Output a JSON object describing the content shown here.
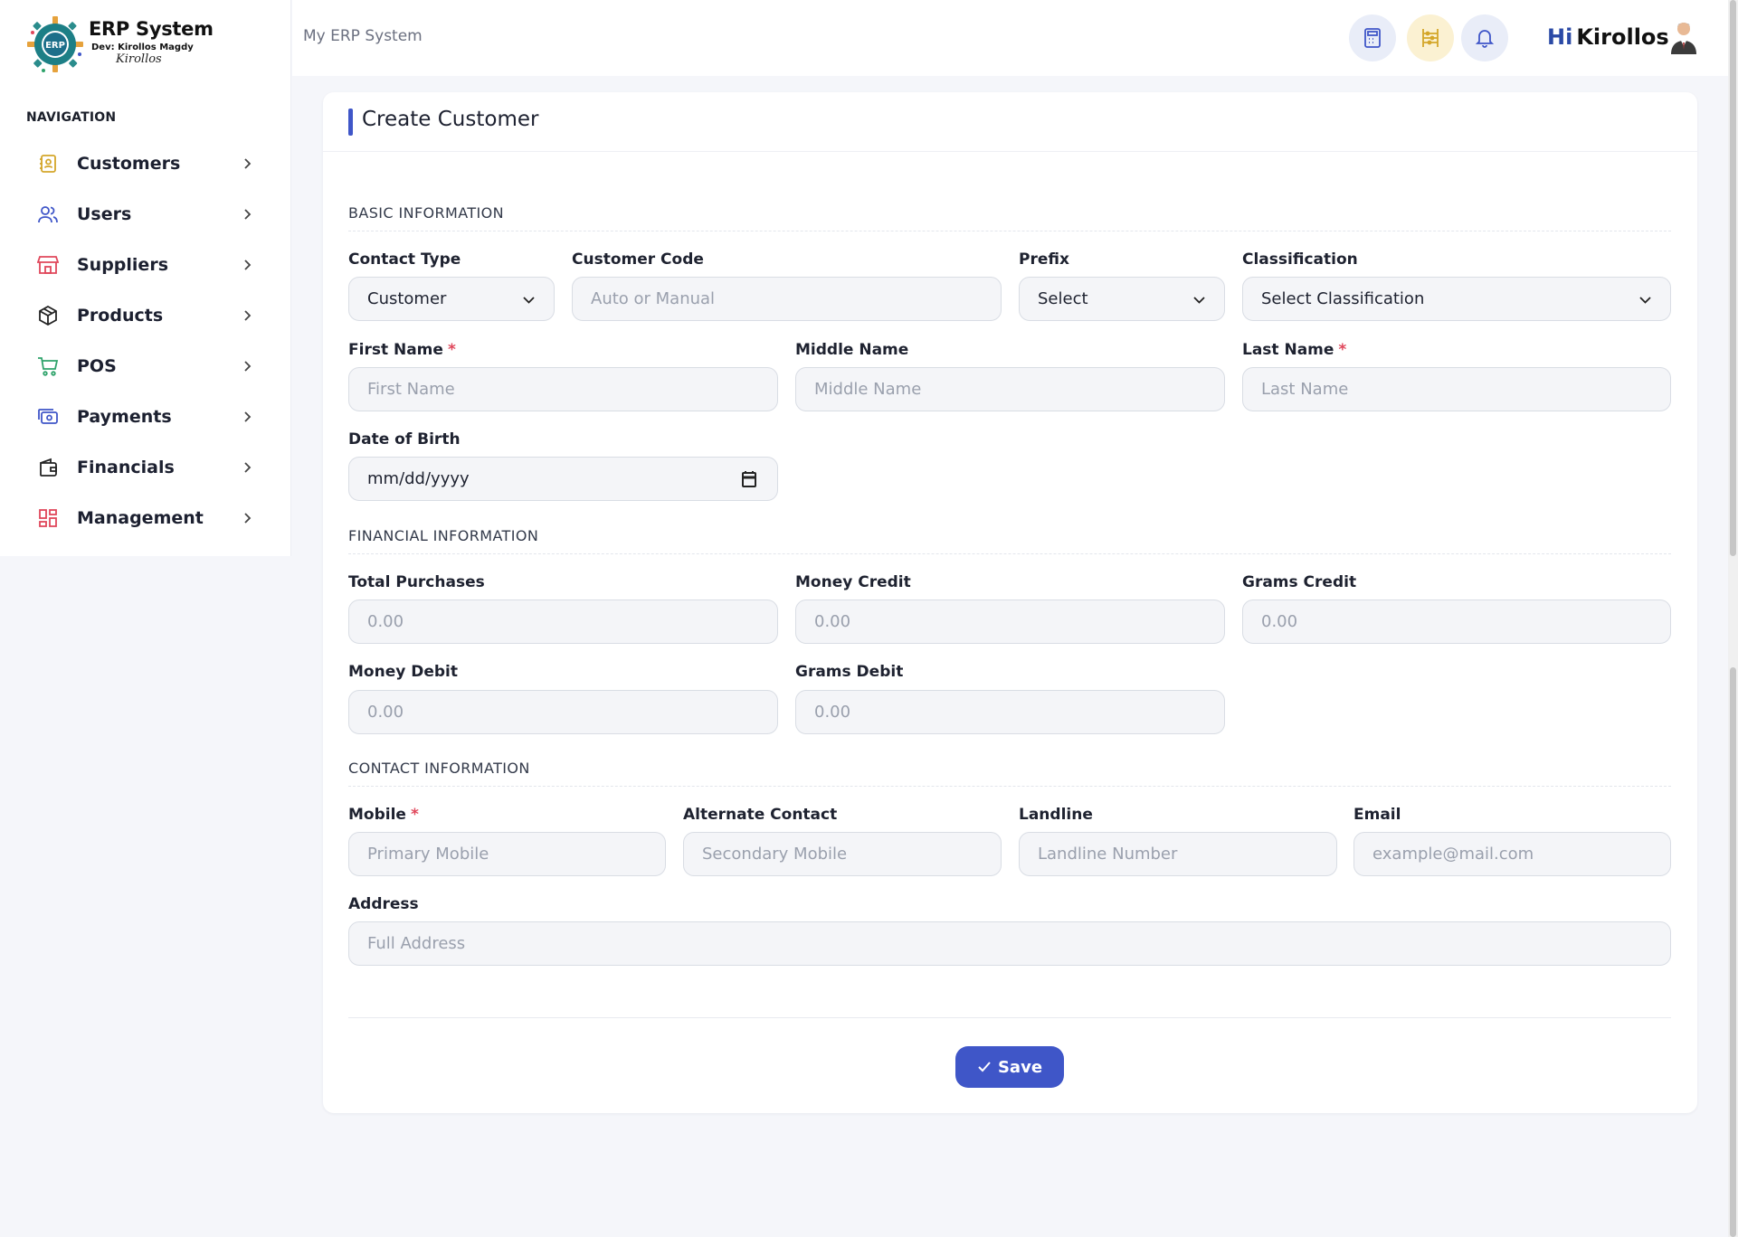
{
  "brand": {
    "title": "ERP System",
    "dev": "Dev: Kirollos Magdy",
    "signature": "Kirollos",
    "logo_text": "ERP"
  },
  "sidebar": {
    "heading": "NAVIGATION",
    "items": [
      {
        "label": "Customers",
        "icon": "contact-book-icon",
        "color": "#d4a62a"
      },
      {
        "label": "Users",
        "icon": "users-icon",
        "color": "#3f56c8"
      },
      {
        "label": "Suppliers",
        "icon": "store-icon",
        "color": "#e0475b"
      },
      {
        "label": "Products",
        "icon": "package-icon",
        "color": "#222222"
      },
      {
        "label": "POS",
        "icon": "cart-icon",
        "color": "#2fa36b"
      },
      {
        "label": "Payments",
        "icon": "payment-icon",
        "color": "#3f56c8"
      },
      {
        "label": "Financials",
        "icon": "wallet-icon",
        "color": "#222222"
      },
      {
        "label": "Management",
        "icon": "dashboard-icon",
        "color": "#e0475b"
      }
    ]
  },
  "topbar": {
    "title": "My ERP System",
    "greeting_hi": "Hi",
    "greeting_name": "Kirollos",
    "buttons": [
      {
        "icon": "calculator-icon",
        "bg": "#e9edf8"
      },
      {
        "icon": "abacus-icon",
        "bg": "#fbf1d2"
      },
      {
        "icon": "bell-icon",
        "bg": "#e9edf8"
      }
    ]
  },
  "form": {
    "title": "Create Customer",
    "sections": {
      "basic": "BASIC INFORMATION",
      "financial": "FINANCIAL INFORMATION",
      "contact": "CONTACT INFORMATION"
    },
    "fields": {
      "contact_type": {
        "label": "Contact Type",
        "value": "Customer"
      },
      "customer_code": {
        "label": "Customer Code",
        "placeholder": "Auto or Manual"
      },
      "prefix": {
        "label": "Prefix",
        "value": "Select"
      },
      "classification": {
        "label": "Classification",
        "value": "Select Classification"
      },
      "first_name": {
        "label": "First Name",
        "placeholder": "First Name",
        "required": "*"
      },
      "middle_name": {
        "label": "Middle Name",
        "placeholder": "Middle Name"
      },
      "last_name": {
        "label": "Last Name",
        "placeholder": "Last Name",
        "required": "*"
      },
      "dob": {
        "label": "Date of Birth",
        "value": "mm/dd/yyyy"
      },
      "total_purchases": {
        "label": "Total Purchases",
        "placeholder": "0.00"
      },
      "money_credit": {
        "label": "Money Credit",
        "placeholder": "0.00"
      },
      "grams_credit": {
        "label": "Grams Credit",
        "placeholder": "0.00"
      },
      "money_debit": {
        "label": "Money Debit",
        "placeholder": "0.00"
      },
      "grams_debit": {
        "label": "Grams Debit",
        "placeholder": "0.00"
      },
      "mobile": {
        "label": "Mobile",
        "placeholder": "Primary Mobile",
        "required": "*"
      },
      "alt_contact": {
        "label": "Alternate Contact",
        "placeholder": "Secondary Mobile"
      },
      "landline": {
        "label": "Landline",
        "placeholder": "Landline Number"
      },
      "email": {
        "label": "Email",
        "placeholder": "example@mail.com"
      },
      "address": {
        "label": "Address",
        "placeholder": "Full Address"
      }
    },
    "save_label": "Save"
  }
}
